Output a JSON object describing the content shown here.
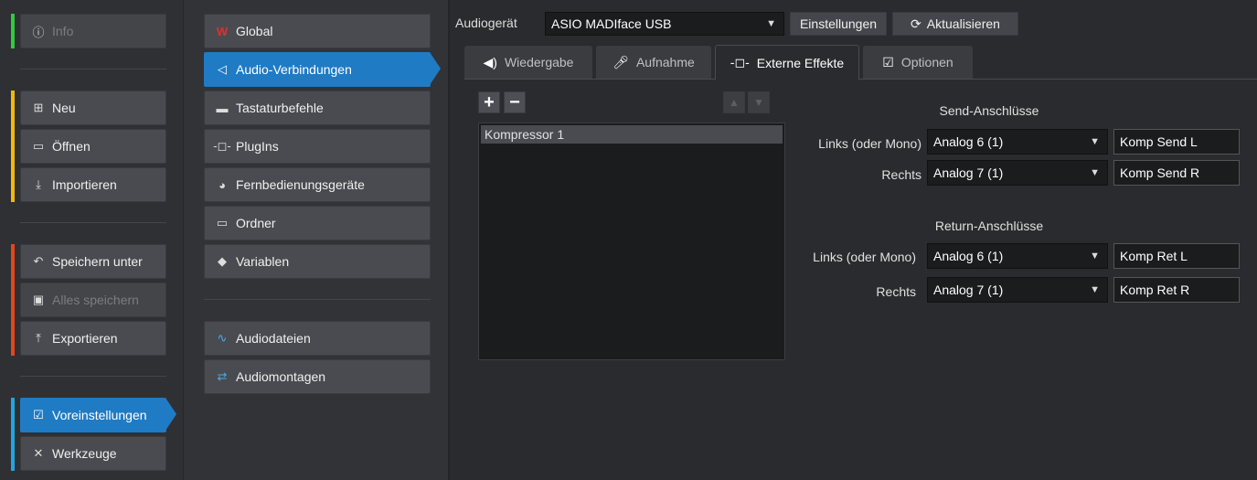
{
  "file_menu": {
    "info": "Info",
    "new": "Neu",
    "open": "Öffnen",
    "import": "Importieren",
    "save_as": "Speichern unter",
    "save_all": "Alles speichern",
    "export": "Exportieren",
    "preferences": "Voreinstellungen",
    "tools": "Werkzeuge"
  },
  "accent_colors": {
    "info": "#2ecc40",
    "file": "#f0b90b",
    "save": "#e8441a",
    "prefs": "#1fa7e0"
  },
  "categories": {
    "global": "Global",
    "audio_connections": "Audio-Verbindungen",
    "shortcuts": "Tastaturbefehle",
    "plugins": "PlugIns",
    "remote": "Fernbedienungsgeräte",
    "folders": "Ordner",
    "variables": "Variablen",
    "audio_files": "Audiodateien",
    "audio_montages": "Audiomontagen"
  },
  "toolbar": {
    "device_label": "Audiogerät",
    "device_value": "ASIO MADIface USB",
    "settings": "Einstellungen",
    "refresh": "Aktualisieren"
  },
  "tabs": {
    "playback": "Wiedergabe",
    "recording": "Aufnahme",
    "external_fx": "Externe Effekte",
    "options": "Optionen"
  },
  "effects_list": [
    "Kompressor 1"
  ],
  "send": {
    "title": "Send-Anschlüsse",
    "left_label": "Links (oder Mono)",
    "left_port": "Analog 6 (1)",
    "left_name": "Komp Send L",
    "right_label": "Rechts",
    "right_port": "Analog 7 (1)",
    "right_name": "Komp Send R"
  },
  "ret": {
    "title": "Return-Anschlüsse",
    "left_label": "Links (oder Mono)",
    "left_port": "Analog 6 (1)",
    "left_name": "Komp Ret L",
    "right_label": "Rechts",
    "right_port": "Analog 7 (1)",
    "right_name": "Komp Ret R"
  }
}
